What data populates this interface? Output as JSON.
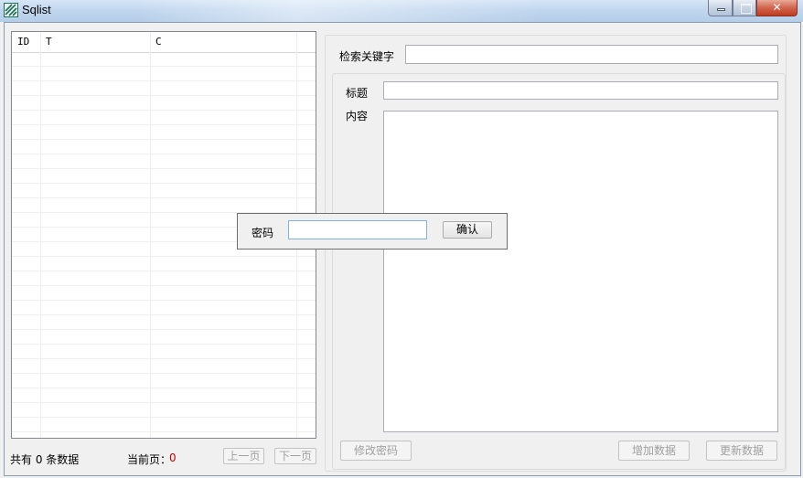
{
  "window": {
    "title": "Sqlist",
    "icon": "app-logo-icon",
    "controls": {
      "minimize": "minimize-icon",
      "maximize": "maximize-icon",
      "close_glyph": "✕"
    }
  },
  "grid": {
    "columns": [
      "ID",
      "T",
      "C"
    ],
    "rows": []
  },
  "footer": {
    "total_text": "共有 0 条数据",
    "current_page_label": "当前页：",
    "current_page_value": "0",
    "prev_label": "上一页",
    "next_label": "下一页"
  },
  "search": {
    "label": "检索关键字",
    "value": ""
  },
  "editor": {
    "title_label": "标题",
    "title_value": "",
    "content_label": "内容",
    "content_value": ""
  },
  "actions": {
    "change_password": "修改密码",
    "add_data": "增加数据",
    "update_data": "更新数据"
  },
  "password_dialog": {
    "label": "密码",
    "value": "",
    "confirm_label": "确认"
  },
  "colors": {
    "page_number": "#c00000",
    "window_bg": "#f0f0f0"
  }
}
